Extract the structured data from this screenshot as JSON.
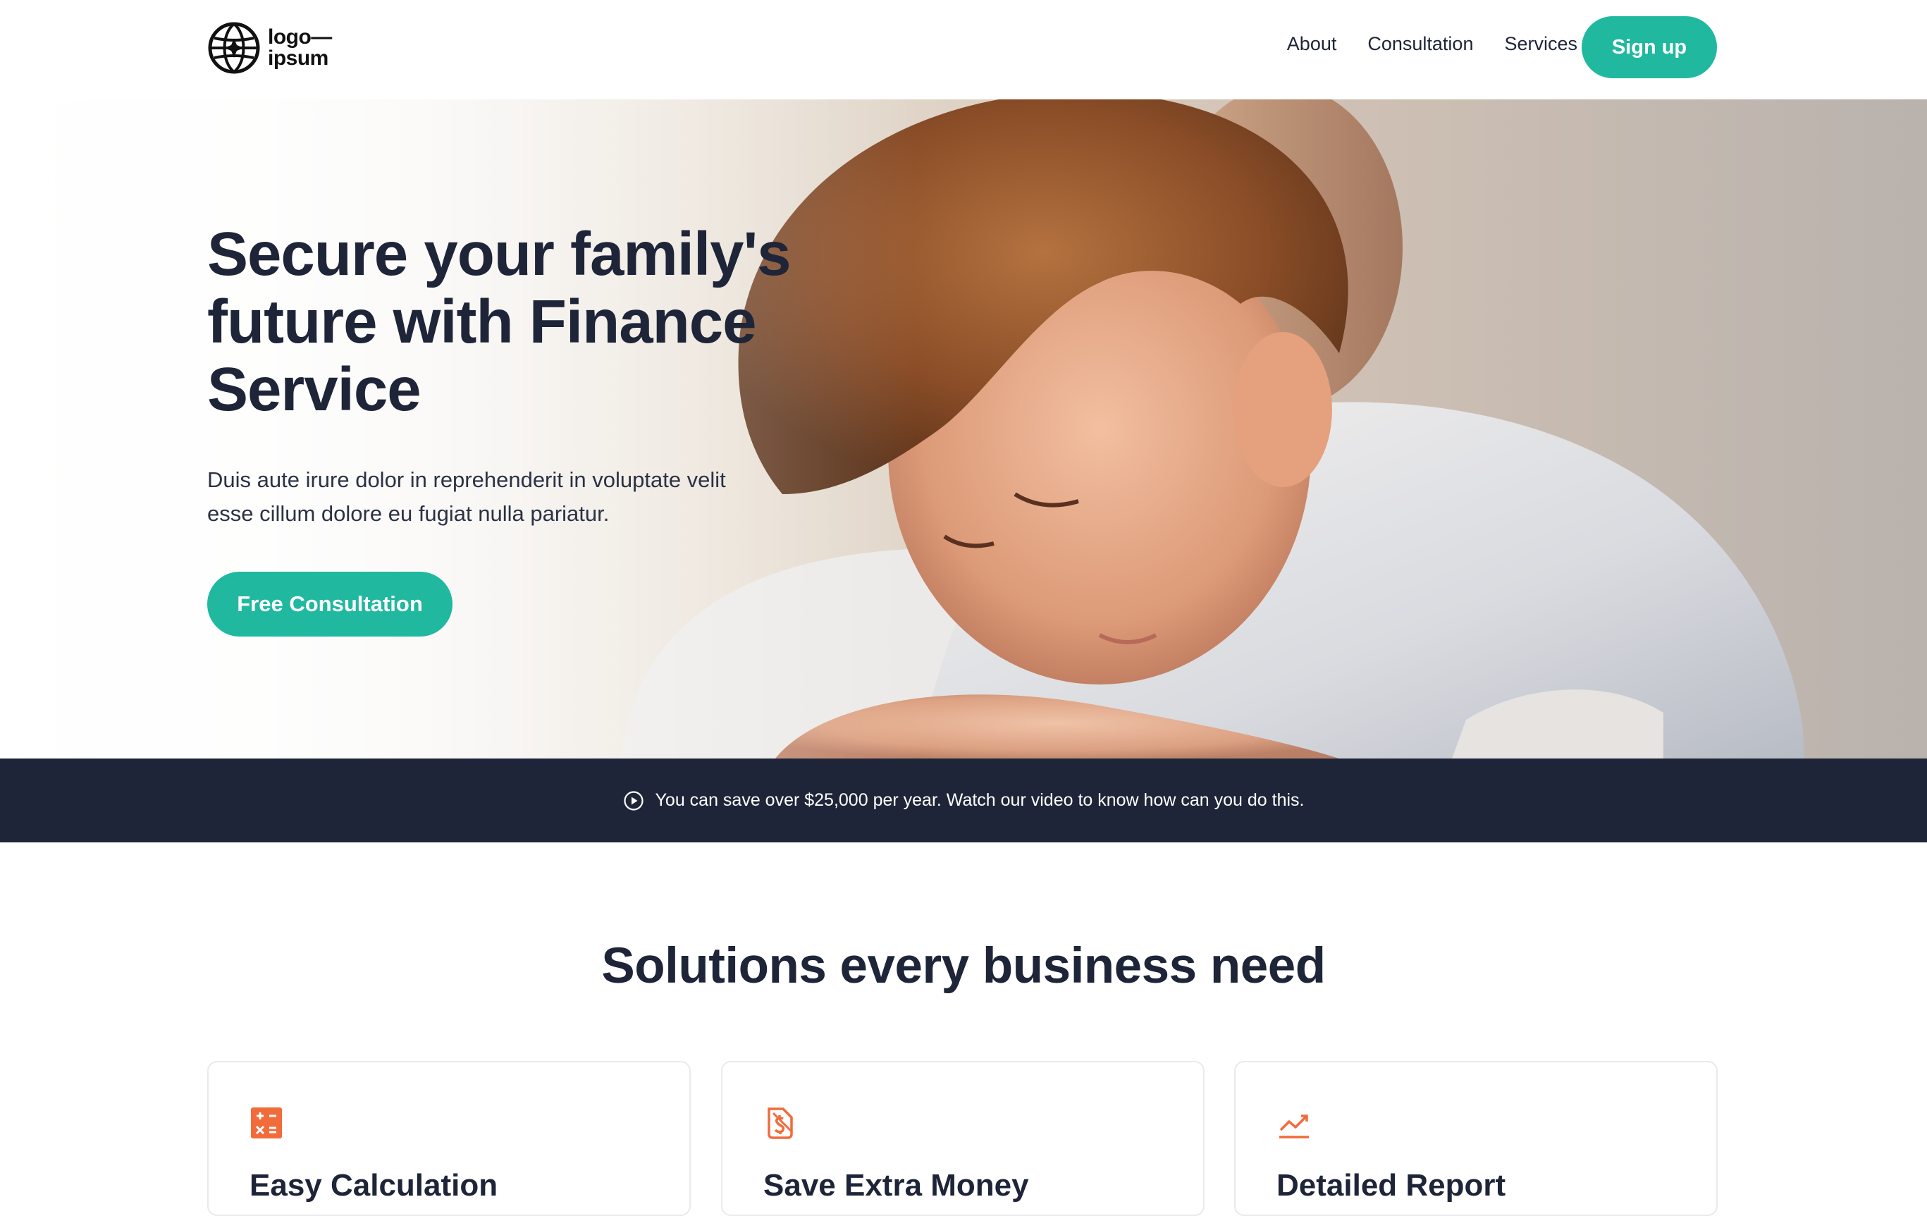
{
  "header": {
    "logo_line1": "logo—",
    "logo_line2": "ipsum",
    "nav": [
      "About",
      "Consultation",
      "Services"
    ],
    "signup_label": "Sign up"
  },
  "hero": {
    "title": "Secure your family's future with Finance Service",
    "subtitle": "Duis aute irure dolor in reprehenderit in voluptate velit esse cillum dolore eu fugiat nulla pariatur.",
    "cta_label": "Free Consultation"
  },
  "banner": {
    "icon": "play-circle-icon",
    "text": "You can save over $25,000 per year. Watch our video to know how can you do this."
  },
  "solutions": {
    "title": "Solutions every business need",
    "cards": [
      {
        "icon": "calculator-icon",
        "title": "Easy Calculation"
      },
      {
        "icon": "money-icon",
        "title": "Save Extra Money"
      },
      {
        "icon": "chart-line-icon",
        "title": "Detailed Report"
      }
    ]
  },
  "colors": {
    "accent": "#21b8a0",
    "dark": "#1e2538",
    "icon_orange": "#f26b3a"
  }
}
